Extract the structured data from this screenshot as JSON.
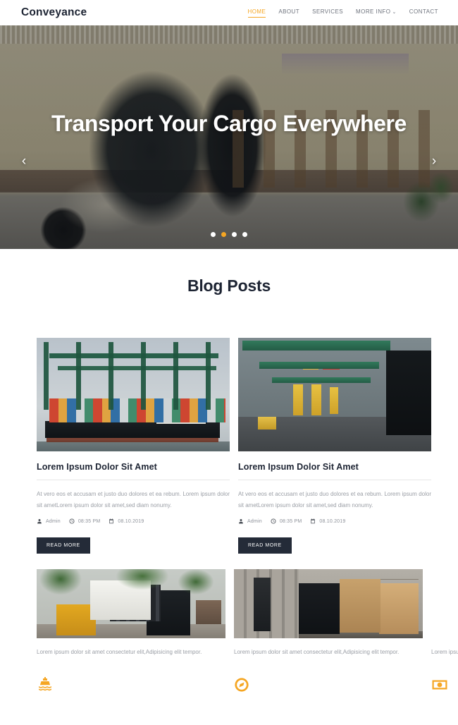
{
  "header": {
    "brand": "Conveyance",
    "nav": [
      {
        "label": "HOME",
        "active": true
      },
      {
        "label": "ABOUT",
        "active": false
      },
      {
        "label": "SERVICES",
        "active": false
      },
      {
        "label": "MORE INFO",
        "active": false,
        "caret": "⌄"
      },
      {
        "label": "CONTACT",
        "active": false
      }
    ]
  },
  "hero": {
    "title": "Transport Your Cargo Everywhere",
    "prev_label": "‹",
    "next_label": "›",
    "dots": [
      false,
      true,
      false,
      false
    ],
    "image_alt": "forklift-in-front-of-colonial-building"
  },
  "blog": {
    "section_title": "Blog Posts",
    "posts": [
      {
        "title": "Lorem Ipsum Dolor Sit Amet",
        "excerpt": "At vero eos et accusam et justo duo dolores et ea rebum. Lorem ipsum dolor sit ametLorem ipsum dolor sit amet,sed diam nonumy.",
        "author": "Admin",
        "time": "08:35 PM",
        "date": "08.10.2019",
        "button_label": "READ MORE",
        "image_alt": "container-ship-at-port"
      },
      {
        "title": "Lorem Ipsum Dolor Sit Amet",
        "excerpt": "At vero eos et accusam et justo duo dolores et ea rebum. Lorem ipsum dolor sit ametLorem ipsum dolor sit amet,sed diam nonumy.",
        "author": "Admin",
        "time": "08:35 PM",
        "date": "08.10.2019",
        "button_label": "READ MORE",
        "image_alt": "port-terminal-straddle-carriers"
      }
    ]
  },
  "features": [
    {
      "text": "Lorem ipsum dolor sit amet consectetur elit,Adipisicing elit tempor.",
      "icon": "ship-icon",
      "image_alt": "truck-and-forklift-loading"
    },
    {
      "text": "Lorem ipsum dolor sit amet consectetur elit,Adipisicing elit tempor.",
      "icon": "compass-icon",
      "image_alt": "forklift-loading-boxes-at-dock"
    },
    {
      "text": "Lorem ipsum dolor sit amet consectetur elit,Adipisicing elit tempor.",
      "icon": "money-icon",
      "image_alt": ""
    }
  ],
  "colors": {
    "accent": "#f5a623",
    "dark": "#242b38",
    "muted_text": "#9a9ea5"
  }
}
